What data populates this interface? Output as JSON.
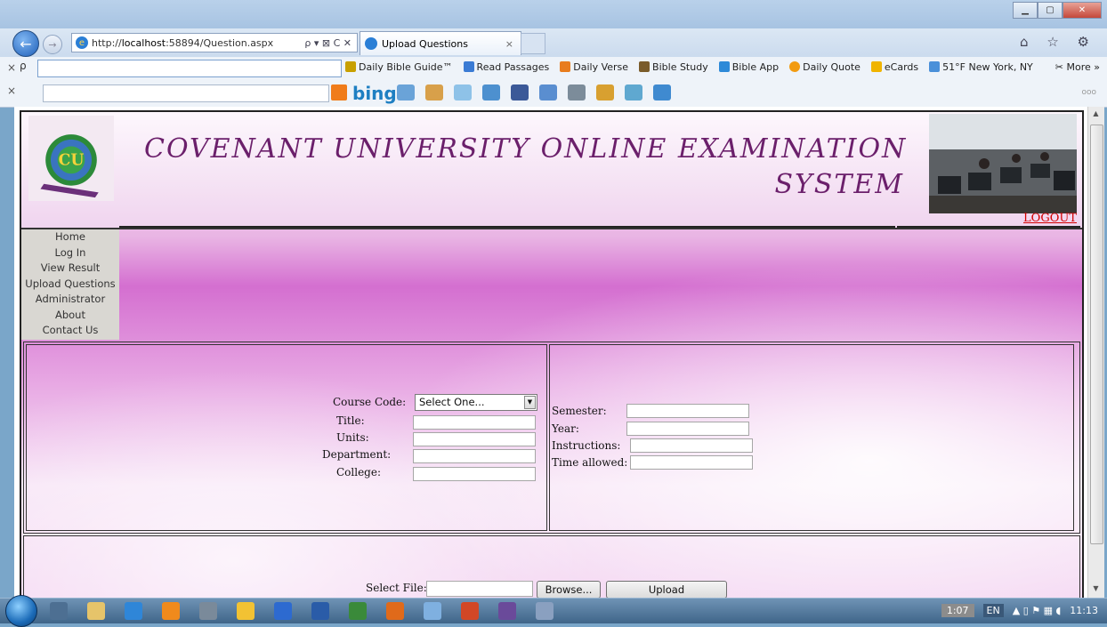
{
  "browser": {
    "url_prefix": "http://",
    "url_host": "localhost",
    "url_rest": ":58894/Question.aspx",
    "address_controls": "ρ ▾ ⊠ C ✕",
    "tab_title": "Upload Questions",
    "tab_close": "×",
    "nav_icons": "⌂ ☆ ⚙"
  },
  "toolbar1": {
    "close_glyph": "×",
    "search_glyph": "ρ",
    "items": [
      {
        "label": "Daily Bible Guide™",
        "color": "#c8a000"
      },
      {
        "label": "Read Passages",
        "color": "#3b7bd4"
      },
      {
        "label": "Daily Verse",
        "color": "#e87d1e"
      },
      {
        "label": "Bible Study",
        "color": "#7a5c2a"
      },
      {
        "label": "Bible App",
        "color": "#2e8ad8"
      },
      {
        "label": "Daily Quote",
        "color": "#f29b10"
      },
      {
        "label": "eCards",
        "color": "#f0b400"
      },
      {
        "label": "51°F New York, NY",
        "color": "#4a90d9"
      }
    ],
    "more": "More"
  },
  "toolbar2": {
    "close_glyph": "×",
    "bing": "bing",
    "dots": "ooo"
  },
  "header": {
    "title_line1": "COVENANT UNIVERSITY ONLINE EXAMINATION",
    "title_line2": "SYSTEM",
    "logout": "LOGOUT",
    "logo_text": "COVENANT UNIVERSITY"
  },
  "menu": [
    "Home",
    "Log In",
    "View Result",
    "Upload Questions",
    "Administrator",
    "About",
    "Contact Us"
  ],
  "form": {
    "course_code_label": "Course Code:",
    "course_code_value": "Select One...",
    "title_label": "Title:",
    "units_label": "Units:",
    "department_label": "Department:",
    "college_label": "College:",
    "semester_label": "Semester:",
    "year_label": "Year:",
    "instructions_label": "Instructions:",
    "time_label": "Time allowed:"
  },
  "upload": {
    "select_file_label": "Select File:",
    "browse_label": "Browse...",
    "upload_label": "Upload"
  },
  "taskbar": {
    "tray_time1": "1:07",
    "lang": "EN",
    "tray_glyphs": "▲ ▯ ⚑ ▦ ◖",
    "clock": "11:13"
  },
  "colors": {
    "title_purple": "#6b1f6b",
    "logout_red": "#d40000",
    "page_pink": "#d46fd0"
  }
}
